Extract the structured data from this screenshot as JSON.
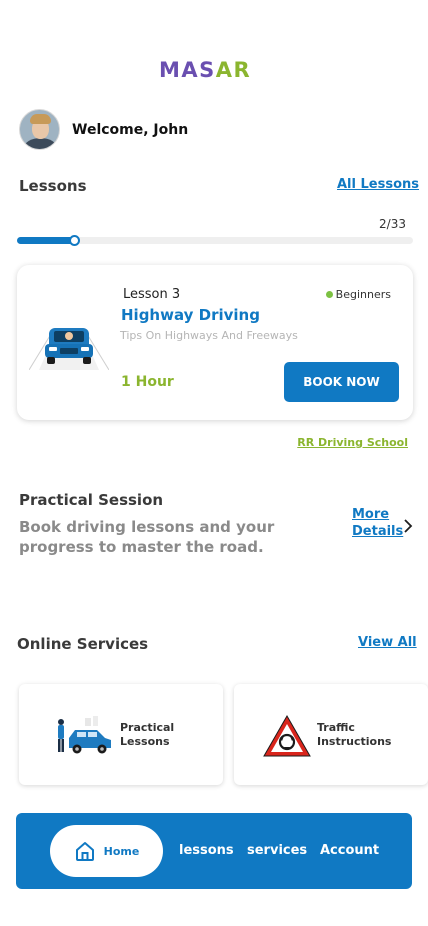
{
  "logo": {
    "part1": "MAS",
    "part2": "AR"
  },
  "header": {
    "welcome": "Welcome, John"
  },
  "lessons": {
    "title": "Lessons",
    "all_link": "All Lessons",
    "progress_text": "2/33",
    "progress": 0.145
  },
  "lesson_card": {
    "number": "Lesson 3",
    "level": "Beginners",
    "title": "Highway Driving",
    "subtitle": "Tips On Highways And Freeways",
    "duration": "1 Hour",
    "button": "BOOK NOW",
    "school": "RR Driving School"
  },
  "practical": {
    "title": "Practical Session",
    "description": "Book driving lessons and your progress to master the road.",
    "more": "More Details"
  },
  "services": {
    "title": "Online Services",
    "view_all": "View All",
    "items": [
      {
        "label_line1": "Practical",
        "label_line2": "Lessons"
      },
      {
        "label_line1": "Traffic",
        "label_line2": "Instructions"
      }
    ]
  },
  "nav": {
    "home": "Home",
    "lessons": "lessons",
    "services": "services",
    "account": "Account"
  },
  "colors": {
    "primary": "#1079c3",
    "accent_green": "#8bb52f",
    "logo_purple": "#6a4fb0"
  },
  "icons": [
    "car-front-icon",
    "chevron-right-icon",
    "home-icon",
    "car-lesson-icon",
    "roundabout-sign-icon"
  ]
}
